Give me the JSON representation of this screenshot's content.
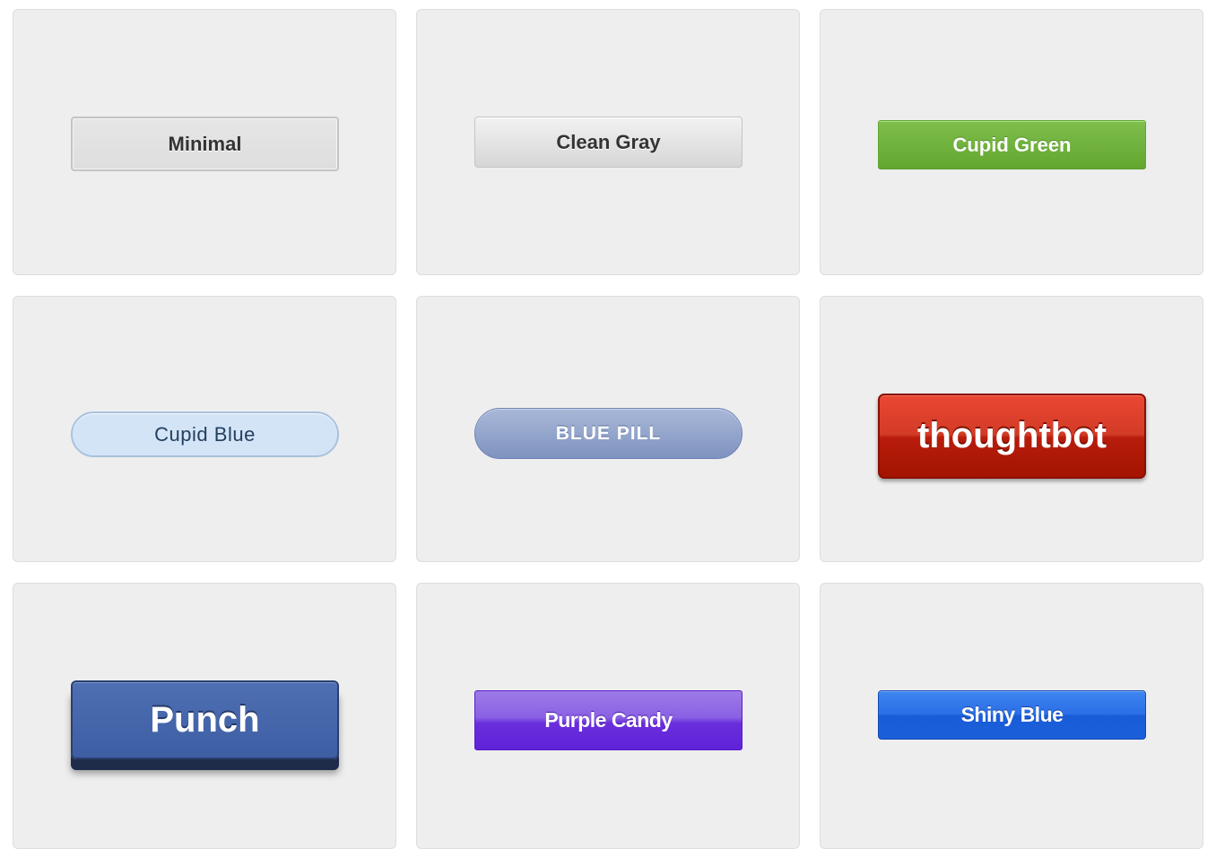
{
  "buttons": {
    "minimal": "Minimal",
    "clean_gray": "Clean Gray",
    "cupid_green": "Cupid Green",
    "cupid_blue": "Cupid Blue",
    "blue_pill": "BLUE PILL",
    "thoughtbot": "thoughtbot",
    "punch": "Punch",
    "purple_candy": "Purple Candy",
    "shiny_blue": "Shiny Blue"
  },
  "colors": {
    "card_background": "#eeeeee",
    "cupid_green": "#6cb33e",
    "cupid_blue": "#d4e4f7",
    "blue_pill": "#8fa1cb",
    "thoughtbot": "#c62811",
    "punch": "#4564aa",
    "purple_candy": "#6a2edc",
    "shiny_blue": "#2a6fe6"
  }
}
